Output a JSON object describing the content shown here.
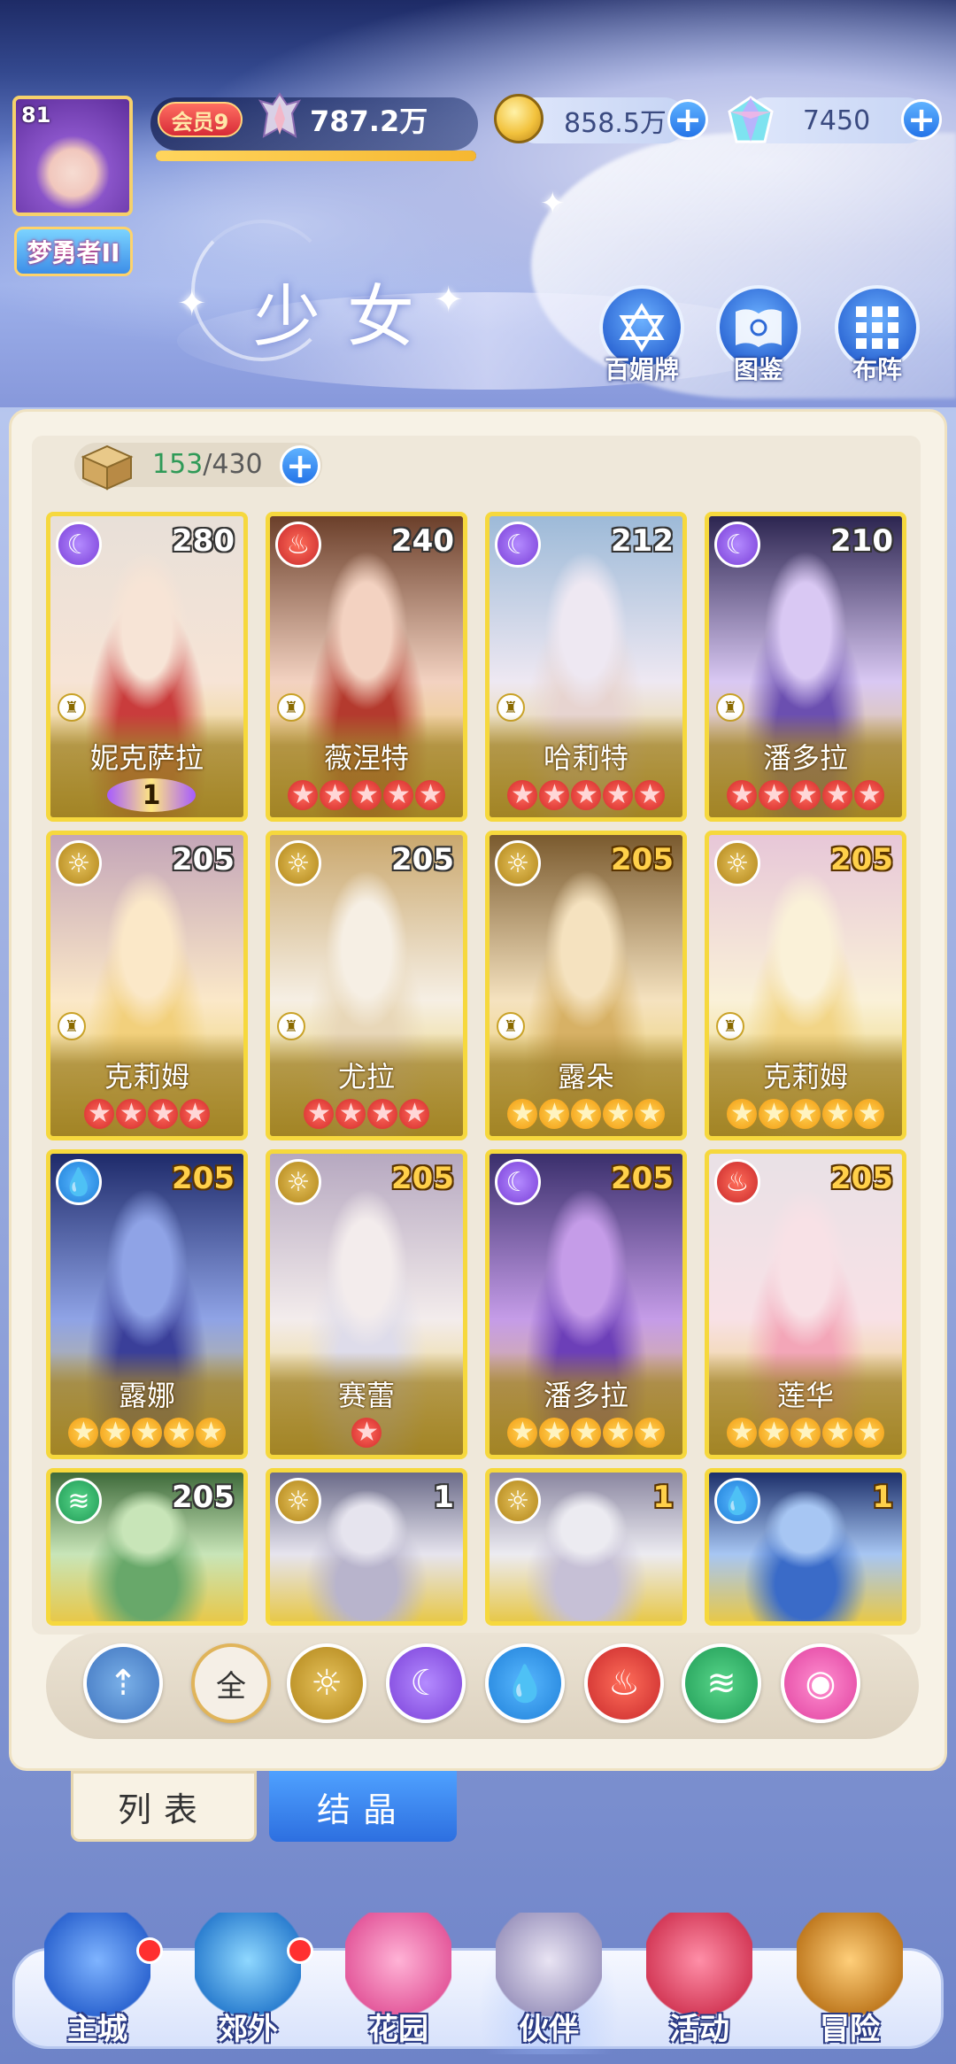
{
  "header": {
    "avatar_level": "81",
    "user_title": "梦勇者II",
    "vip_label": "会员9",
    "power": "787.2万",
    "exp_progress": 1.0,
    "gold": "858.5万",
    "gems": "7450",
    "page_title": "少女",
    "menu": [
      "百媚牌",
      "图鉴",
      "布阵"
    ]
  },
  "inventory": {
    "current": "153",
    "separator_max": "/430"
  },
  "cards": [
    {
      "name": "妮克萨拉",
      "level": "280",
      "element": "moon",
      "stars": 0,
      "star_color": "red",
      "badge": "1"
    },
    {
      "name": "薇涅特",
      "level": "240",
      "element": "fire",
      "stars": 5,
      "star_color": "red"
    },
    {
      "name": "哈莉特",
      "level": "212",
      "element": "moon",
      "stars": 5,
      "star_color": "red"
    },
    {
      "name": "潘多拉",
      "level": "210",
      "element": "moon",
      "stars": 5,
      "star_color": "red"
    },
    {
      "name": "克莉姆",
      "level": "205",
      "element": "sun",
      "stars": 4,
      "star_color": "red"
    },
    {
      "name": "尤拉",
      "level": "205",
      "element": "sun",
      "stars": 4,
      "star_color": "red"
    },
    {
      "name": "露朵",
      "level": "205",
      "element": "sun",
      "stars": 5,
      "star_color": "gold"
    },
    {
      "name": "克莉姆",
      "level": "205",
      "element": "sun",
      "stars": 5,
      "star_color": "gold"
    },
    {
      "name": "露娜",
      "level": "205",
      "element": "water",
      "stars": 5,
      "star_color": "gold"
    },
    {
      "name": "赛蕾",
      "level": "205",
      "element": "sun",
      "stars": 1,
      "star_color": "red"
    },
    {
      "name": "潘多拉",
      "level": "205",
      "element": "moon",
      "stars": 5,
      "star_color": "gold"
    },
    {
      "name": "莲华",
      "level": "205",
      "element": "fire",
      "stars": 5,
      "star_color": "gold"
    },
    {
      "name": "",
      "level": "205",
      "element": "wind",
      "stars": 0,
      "star_color": "gold"
    },
    {
      "name": "",
      "level": "1",
      "element": "sun",
      "stars": 0,
      "star_color": "gold"
    },
    {
      "name": "",
      "level": "1",
      "element": "sun",
      "stars": 0,
      "star_color": "gold"
    },
    {
      "name": "",
      "level": "1",
      "element": "water",
      "stars": 0,
      "star_color": "gold"
    }
  ],
  "filters": [
    "favorite",
    "全",
    "sun",
    "moon",
    "water",
    "fire",
    "wind",
    "heart"
  ],
  "tabs": {
    "list": "列表",
    "crystal": "结晶"
  },
  "nav": [
    "主城",
    "郊外",
    "花园",
    "伙伴",
    "活动",
    "冒险"
  ],
  "colors": {
    "accent": "#2d6fe0",
    "card_frame": "#f6d83d",
    "star_red": "#d22a2a",
    "star_gold": "#f29b12"
  }
}
